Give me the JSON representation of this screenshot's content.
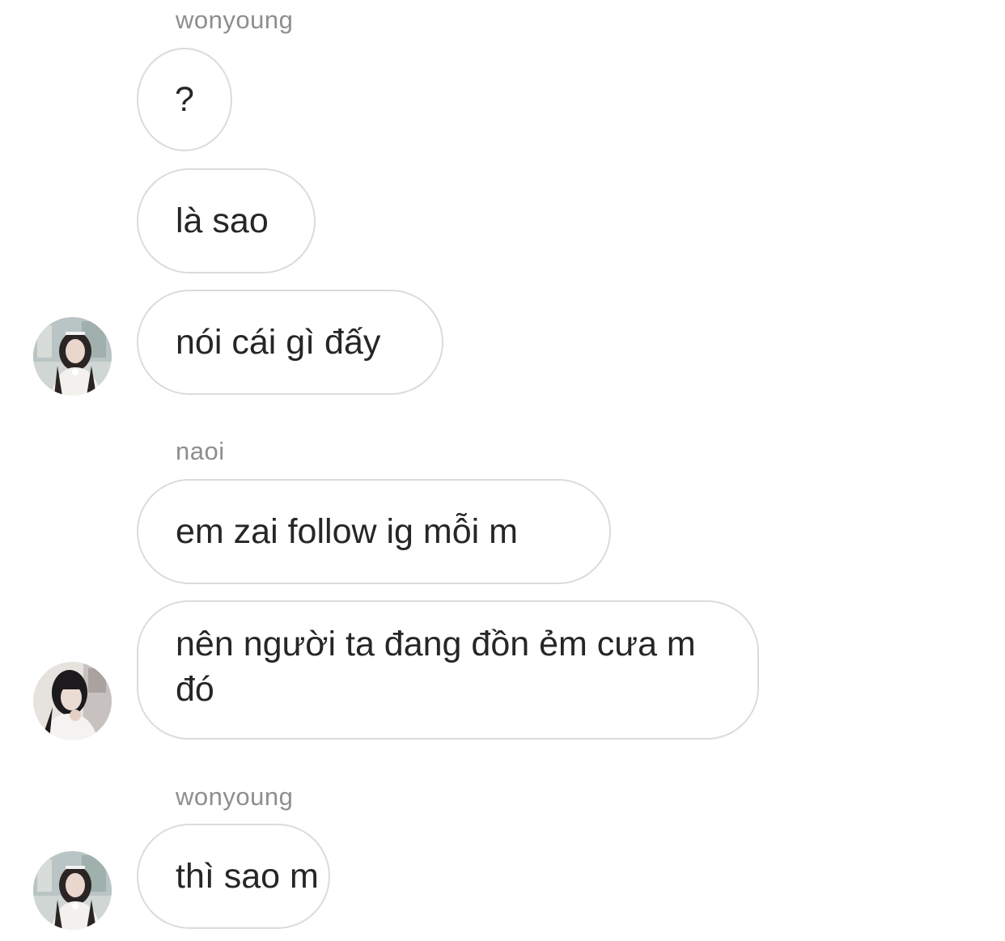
{
  "conversation": {
    "groups": [
      {
        "sender": "wonyoung",
        "messages": [
          "?",
          "là sao",
          "nói cái gì đấy"
        ],
        "avatar_icon": "user-avatar-photo"
      },
      {
        "sender": "naoi",
        "messages": [
          "em zai follow ig mỗi m",
          "nên người ta đang đồn ẻm cưa m đó"
        ],
        "avatar_icon": "user-avatar-photo"
      },
      {
        "sender": "wonyoung",
        "messages": [
          "thì sao m"
        ],
        "avatar_icon": "user-avatar-photo"
      }
    ]
  },
  "colors": {
    "background": "#ffffff",
    "bubble_border": "#dbdbdb",
    "sender_text": "#8e8e8e",
    "message_text": "#262626"
  }
}
